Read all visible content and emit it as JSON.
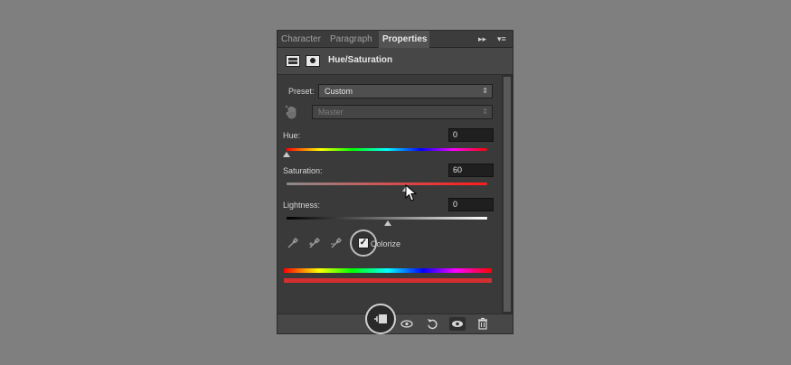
{
  "tabs": [
    {
      "label": "Character",
      "active": false
    },
    {
      "label": "Paragraph",
      "active": false
    },
    {
      "label": "Properties",
      "active": true
    }
  ],
  "tab_controls": {
    "collapse": "▸▸",
    "menu": "▾≡"
  },
  "header": {
    "title": "Hue/Saturation",
    "icons": [
      "adjustment-layer-icon",
      "layer-mask-icon"
    ]
  },
  "preset": {
    "label": "Preset:",
    "value": "Custom"
  },
  "channel": {
    "value": "Master",
    "icon": "targeted-adjustment-hand-icon"
  },
  "hue": {
    "label": "Hue:",
    "value": "0"
  },
  "saturation": {
    "label": "Saturation:",
    "value": "60"
  },
  "lightness": {
    "label": "Lightness:",
    "value": "0"
  },
  "colorize": {
    "label": "Colorize",
    "checked": true
  },
  "eyedroppers": [
    "eyedropper-icon",
    "eyedropper-add-icon",
    "eyedropper-subtract-icon"
  ],
  "footer_icons": [
    "clip-to-layer-icon",
    "view-previous-state-icon",
    "reset-icon",
    "visibility-eye-icon",
    "trash-icon"
  ],
  "colors": {
    "colorize_bar": "#d32f2f"
  }
}
